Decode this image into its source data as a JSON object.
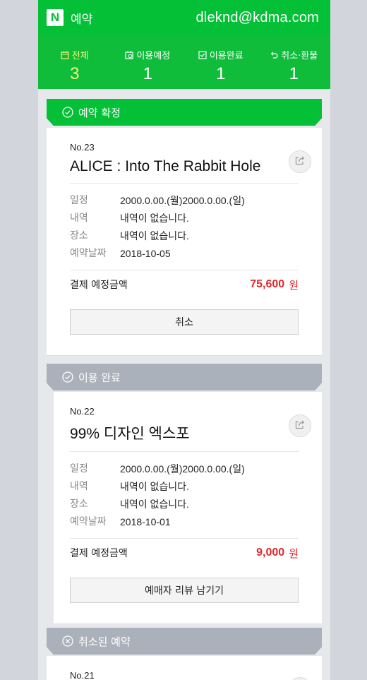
{
  "header": {
    "logo": "N",
    "title": "예약",
    "email": "dleknd@kdma.com"
  },
  "stats": [
    {
      "label": "전체",
      "count": "3",
      "icon": "calendar-icon",
      "active": true
    },
    {
      "label": "이용예정",
      "count": "1",
      "icon": "calendar-clock-icon",
      "active": false
    },
    {
      "label": "이용완료",
      "count": "1",
      "icon": "check-box-icon",
      "active": false
    },
    {
      "label": "취소·환불",
      "count": "1",
      "icon": "undo-icon",
      "active": false
    }
  ],
  "sections": [
    {
      "ribbon": "예약 확정",
      "ribbon_icon": "check-circle-icon",
      "color": "#03c036",
      "card": {
        "no": "No.23",
        "title": "ALICE : Into The Rabbit Hole",
        "rows": [
          {
            "k": "일정",
            "v": "2000.0.00.(월)2000.0.00.(일)"
          },
          {
            "k": "내역",
            "v": "내역이 없습니다."
          },
          {
            "k": "장소",
            "v": "내역이 없습니다."
          },
          {
            "k": "예약날짜",
            "v": "2018-10-05"
          }
        ],
        "price_label": "결제 예정금액",
        "price": "75,600",
        "unit": "원",
        "button": "취소"
      }
    },
    {
      "ribbon": "이용 완료",
      "ribbon_icon": "check-circle-icon",
      "color": "#abb1ba",
      "card": {
        "no": "No.22",
        "title": "99% 디자인 엑스포",
        "rows": [
          {
            "k": "일정",
            "v": "2000.0.00.(월)2000.0.00.(일)"
          },
          {
            "k": "내역",
            "v": "내역이 없습니다."
          },
          {
            "k": "장소",
            "v": "내역이 없습니다."
          },
          {
            "k": "예약날짜",
            "v": "2018-10-01"
          }
        ],
        "price_label": "결제 예정금액",
        "price": "9,000",
        "unit": "원",
        "button": "예매자 리뷰 남기기"
      }
    },
    {
      "ribbon": "취소된 예약",
      "ribbon_icon": "x-circle-icon",
      "color": "#abb1ba",
      "card": {
        "no": "No.21"
      }
    }
  ]
}
